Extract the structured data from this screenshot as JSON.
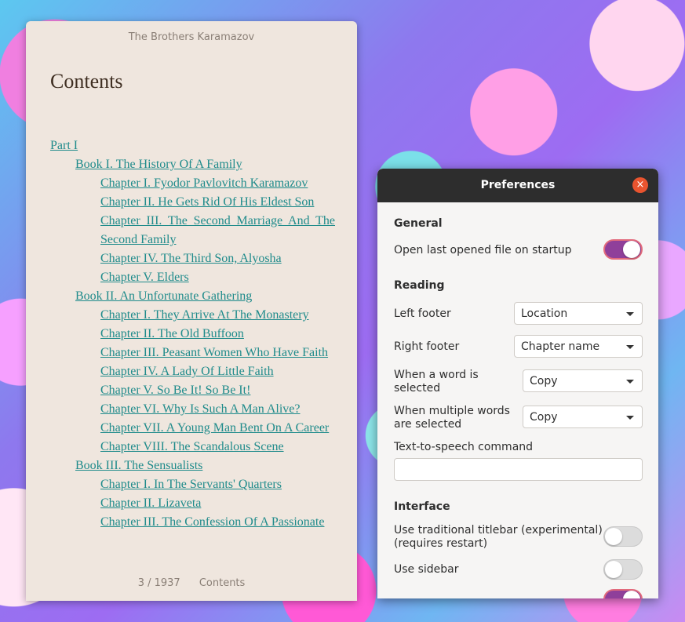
{
  "reader": {
    "title": "The Brothers Karamazov",
    "heading": "Contents",
    "toc": [
      {
        "level": 1,
        "label": "Part I"
      },
      {
        "level": 2,
        "label": "Book I. The History Of A Family"
      },
      {
        "level": 3,
        "label": "Chapter I. Fyodor Pavlovitch Karamazov"
      },
      {
        "level": 3,
        "label": "Chapter II. He Gets Rid Of His Eldest Son"
      },
      {
        "level": 3,
        "label": "Chapter III. The Second Marriage And The Second Family"
      },
      {
        "level": 3,
        "label": "Chapter IV. The Third Son, Alyosha"
      },
      {
        "level": 3,
        "label": "Chapter V. Elders"
      },
      {
        "level": 2,
        "label": "Book II. An Unfortunate Gathering"
      },
      {
        "level": 3,
        "label": "Chapter I. They Arrive At The Monastery"
      },
      {
        "level": 3,
        "label": "Chapter II. The Old Buffoon"
      },
      {
        "level": 3,
        "label": "Chapter III. Peasant Women Who Have Faith"
      },
      {
        "level": 3,
        "label": "Chapter IV. A Lady Of Little Faith"
      },
      {
        "level": 3,
        "label": "Chapter V. So Be It! So Be It!"
      },
      {
        "level": 3,
        "label": "Chapter VI. Why Is Such A Man Alive?"
      },
      {
        "level": 3,
        "label": "Chapter VII. A Young Man Bent On A Career"
      },
      {
        "level": 3,
        "label": "Chapter VIII. The Scandalous Scene"
      },
      {
        "level": 2,
        "label": "Book III. The Sensualists"
      },
      {
        "level": 3,
        "label": "Chapter I. In The Servants' Quarters"
      },
      {
        "level": 3,
        "label": "Chapter II. Lizaveta"
      },
      {
        "level": 3,
        "label": "Chapter III. The Confession Of A Passionate"
      }
    ],
    "footer": {
      "page": "3 / 1937",
      "location": "Contents"
    }
  },
  "prefs": {
    "title": "Preferences",
    "close_icon": "×",
    "general": {
      "heading": "General",
      "open_last_label": "Open last opened file on startup",
      "open_last_on": true
    },
    "reading": {
      "heading": "Reading",
      "left_footer_label": "Left footer",
      "left_footer_value": "Location",
      "right_footer_label": "Right footer",
      "right_footer_value": "Chapter name",
      "word_selected_label_1": "When a word is",
      "word_selected_label_2": "selected",
      "word_selected_value": "Copy",
      "multi_selected_label_1": "When multiple words",
      "multi_selected_label_2": "are selected",
      "multi_selected_value": "Copy",
      "tts_label": "Text-to-speech command",
      "tts_value": ""
    },
    "interface": {
      "heading": "Interface",
      "traditional_label_1": "Use traditional titlebar (experimental)",
      "traditional_label_2": "(requires restart)",
      "traditional_on": false,
      "sidebar_label": "Use sidebar",
      "sidebar_on": false,
      "autohide_on": true
    }
  },
  "colors": {
    "accent": "#8f3f9a",
    "link": "#1f8b8b",
    "close": "#e9542f"
  }
}
